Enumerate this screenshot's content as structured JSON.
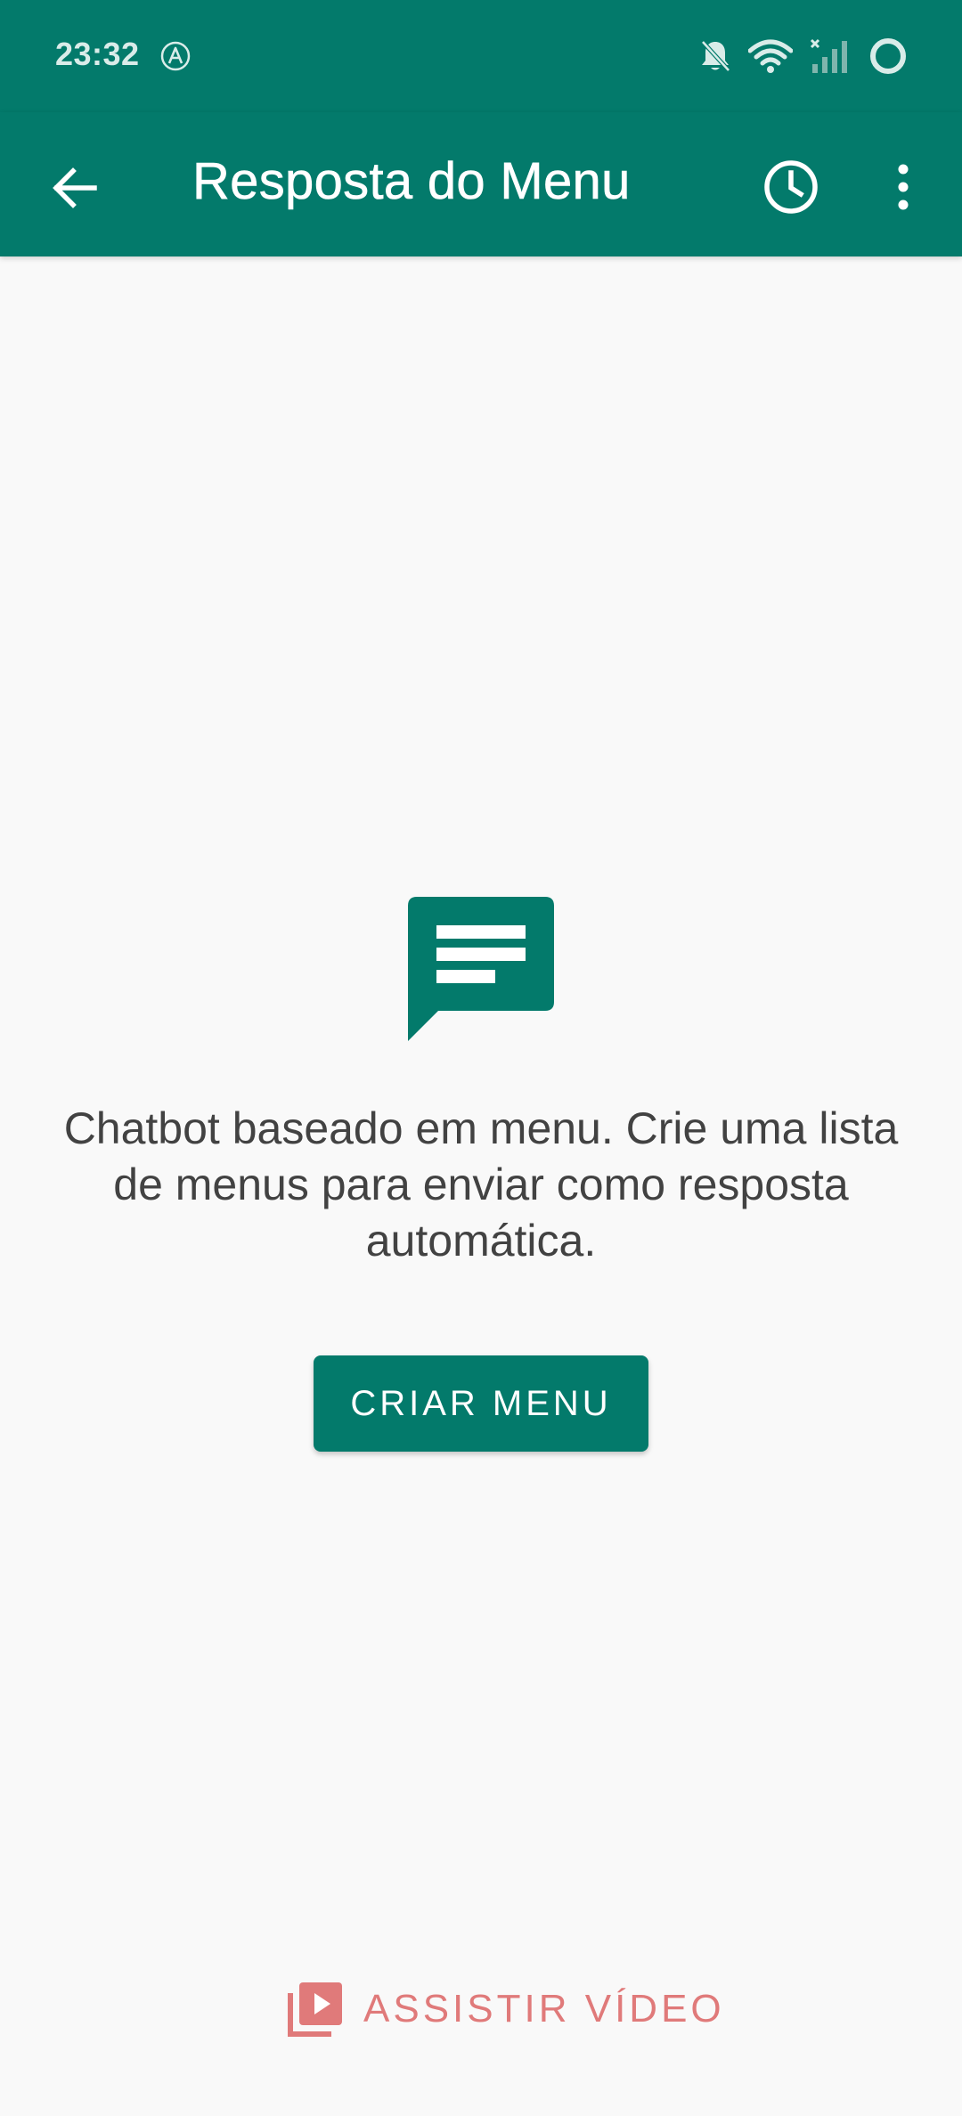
{
  "status_bar": {
    "time": "23:32"
  },
  "app_bar": {
    "title": "Resposta do Menu"
  },
  "empty_state": {
    "message": "Chatbot baseado em menu. Crie uma lista de menus para enviar como resposta automática.",
    "button_label": "CRIAR MENU"
  },
  "footer": {
    "watch_video_label": "ASSISTIR VÍDEO"
  },
  "colors": {
    "primary": "#037a6b",
    "accent": "#e07a7a",
    "background": "#f9f9f9",
    "text": "#424242"
  },
  "icons": {
    "status_left": [
      "auto-a-icon"
    ],
    "status_right": [
      "notifications-off-icon",
      "wifi-icon",
      "cellular-signal-off-icon",
      "sync-circle-icon"
    ],
    "app_bar": [
      "back-arrow-icon",
      "history-clock-icon",
      "more-vert-icon"
    ],
    "empty_state": "chat-message-icon",
    "footer": "video-library-icon"
  }
}
